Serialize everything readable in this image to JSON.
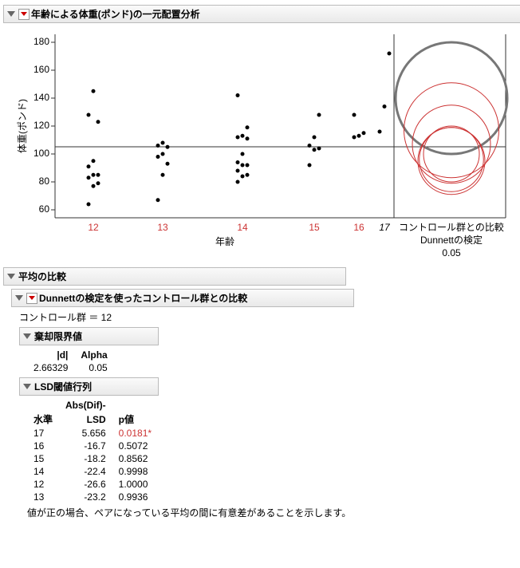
{
  "title_main": "年齢による体重(ポンド)の一元配置分析",
  "chart": {
    "ylabel": "体重(ポンド)",
    "xlabel": "年齢",
    "x_ticks": [
      "12",
      "13",
      "14",
      "15",
      "16",
      "17"
    ],
    "y_ticks": [
      "60",
      "80",
      "100",
      "120",
      "140",
      "160",
      "180"
    ],
    "right_l1": "コントロール群との比較",
    "right_l2": "Dunnettの検定",
    "right_l3": "0.05"
  },
  "section_means": "平均の比較",
  "section_dunnett": "Dunnettの検定を使ったコントロール群との比較",
  "control_label": "コントロール群 ＝  12",
  "section_crit": "棄却限界値",
  "crit_hdr_d": "|d|",
  "crit_hdr_a": "Alpha",
  "crit_d": "2.66329",
  "crit_a": "0.05",
  "section_lsd": "LSD閾値行列",
  "lsd_hdr_level": "水準",
  "lsd_hdr_diff1": "Abs(Dif)-",
  "lsd_hdr_diff2": "LSD",
  "lsd_hdr_p": "p値",
  "lsd_rows": [
    {
      "lvl": "17",
      "diff": "5.656",
      "p": "0.0181*",
      "sig": true
    },
    {
      "lvl": "16",
      "diff": "-16.7",
      "p": "0.5072",
      "sig": false
    },
    {
      "lvl": "15",
      "diff": "-18.2",
      "p": "0.8562",
      "sig": false
    },
    {
      "lvl": "14",
      "diff": "-22.4",
      "p": "0.9998",
      "sig": false
    },
    {
      "lvl": "12",
      "diff": "-26.6",
      "p": "1.0000",
      "sig": false
    },
    {
      "lvl": "13",
      "diff": "-23.2",
      "p": "0.9936",
      "sig": false
    }
  ],
  "note": "値が正の場合、ペアになっている平均の間に有意差があることを示します。",
  "chart_data": {
    "type": "scatter",
    "title": "年齢による体重(ポンド)の一元配置分析",
    "xlabel": "年齢",
    "ylabel": "体重(ポンド)",
    "ylim": [
      55,
      185
    ],
    "grand_mean": 105,
    "comparison": "Dunnett",
    "alpha": 0.05,
    "control_group": "12",
    "series": [
      {
        "name": "12",
        "values": [
          64,
          77,
          79,
          83,
          85,
          85,
          91,
          95,
          123,
          128,
          145
        ]
      },
      {
        "name": "13",
        "values": [
          67,
          85,
          93,
          98,
          100,
          105,
          106,
          108
        ]
      },
      {
        "name": "14",
        "values": [
          80,
          84,
          85,
          88,
          92,
          92,
          94,
          100,
          111,
          112,
          113,
          119,
          142
        ]
      },
      {
        "name": "15",
        "values": [
          92,
          103,
          104,
          106,
          112,
          128
        ]
      },
      {
        "name": "16",
        "values": [
          112,
          113,
          115,
          128
        ]
      },
      {
        "name": "17",
        "values": [
          116,
          134,
          172
        ]
      }
    ],
    "right_panel_circles": [
      {
        "group": "17",
        "center": 140,
        "radius": 40,
        "color": "#777",
        "stroke": 3
      },
      {
        "group": "16",
        "center": 117,
        "radius": 34,
        "color": "#cc3333",
        "stroke": 1
      },
      {
        "group": "15",
        "center": 107,
        "radius": 28,
        "color": "#cc3333",
        "stroke": 1
      },
      {
        "group": "14",
        "center": 100,
        "radius": 20,
        "color": "#cc3333",
        "stroke": 1
      },
      {
        "group": "13",
        "center": 95,
        "radius": 24,
        "color": "#cc3333",
        "stroke": 1
      },
      {
        "group": "12",
        "center": 96,
        "radius": 23,
        "color": "#cc3333",
        "stroke": 1
      }
    ]
  }
}
